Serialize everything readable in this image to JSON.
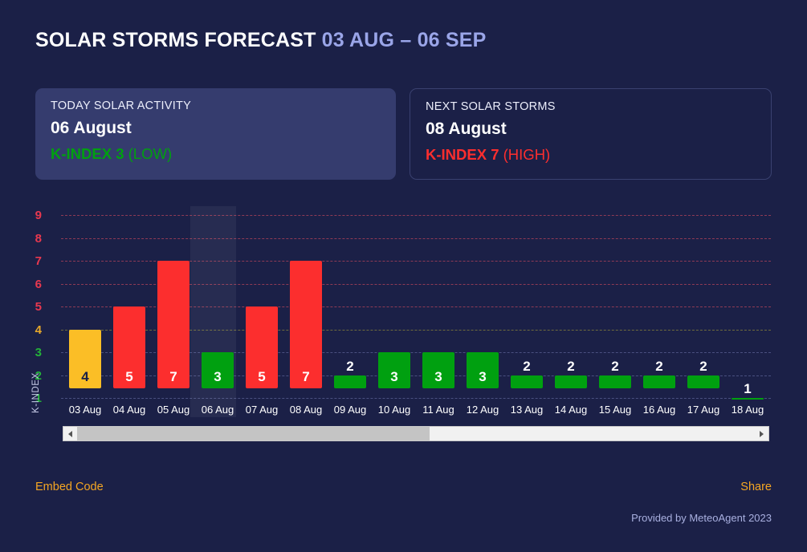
{
  "header": {
    "title_main": "SOLAR STORMS FORECAST",
    "title_range": "03 AUG – 06 SEP"
  },
  "cards": [
    {
      "name": "today-solar-activity",
      "label": "TODAY SOLAR ACTIVITY",
      "date": "06 August",
      "k_text": "K-INDEX 3",
      "severity": "(LOW)",
      "color": "#00a010"
    },
    {
      "name": "next-solar-storms",
      "label": "NEXT SOLAR STORMS",
      "date": "08 August",
      "k_text": "K-INDEX 7",
      "severity": "(HIGH)",
      "color": "#fc2e2e"
    }
  ],
  "chart_data": {
    "type": "bar",
    "title": "SOLAR STORMS FORECAST 03 AUG – 06 SEP",
    "xlabel": "",
    "ylabel": "K-INDEX",
    "ylim": [
      1,
      9
    ],
    "grid": true,
    "legend": "none",
    "categories": [
      "03 Aug",
      "04 Aug",
      "05 Aug",
      "06 Aug",
      "07 Aug",
      "08 Aug",
      "09 Aug",
      "10 Aug",
      "11 Aug",
      "12 Aug",
      "13 Aug",
      "14 Aug",
      "15 Aug",
      "16 Aug",
      "17 Aug",
      "18 Aug"
    ],
    "values": [
      4,
      5,
      7,
      3,
      5,
      7,
      2,
      3,
      3,
      3,
      2,
      2,
      2,
      2,
      2,
      1
    ],
    "bar_colors": [
      "#fbbe26",
      "#fc2e2e",
      "#fc2e2e",
      "#00a010",
      "#fc2e2e",
      "#fc2e2e",
      "#00a010",
      "#00a010",
      "#00a010",
      "#00a010",
      "#00a010",
      "#00a010",
      "#00a010",
      "#00a010",
      "#00a010",
      "#00a010"
    ],
    "value_label_colors": [
      "#1b2047",
      "#ffffff",
      "#ffffff",
      "#ffffff",
      "#ffffff",
      "#ffffff",
      "#ffffff",
      "#ffffff",
      "#ffffff",
      "#ffffff",
      "#ffffff",
      "#ffffff",
      "#ffffff",
      "#ffffff",
      "#ffffff",
      "#ffffff"
    ],
    "highlighted_category": "06 Aug",
    "yticks": [
      9,
      8,
      7,
      6,
      5,
      4,
      3,
      2,
      1
    ],
    "ytick_colors": {
      "9": "#e8384f",
      "8": "#e8384f",
      "7": "#e8384f",
      "6": "#e8384f",
      "5": "#e8384f",
      "4": "#e8a92a",
      "3": "#24b33a",
      "2": "#24b33a",
      "1": "#24b33a"
    },
    "gridline_colors": {
      "9": "#8e3a55",
      "8": "#8e3a55",
      "7": "#8e3a55",
      "6": "#8e3a55",
      "5": "#8e3a55",
      "4": "#6d6a3c",
      "3": "#4a5080",
      "2": "#4a5080",
      "1": "#4a5080"
    }
  },
  "scrollbar": {
    "left_arrow": "◀",
    "right_arrow": "▶",
    "thumb_percent": 52
  },
  "footer": {
    "embed_code": "Embed Code",
    "share": "Share",
    "provided_by": "Provided by MeteoAgent 2023"
  }
}
